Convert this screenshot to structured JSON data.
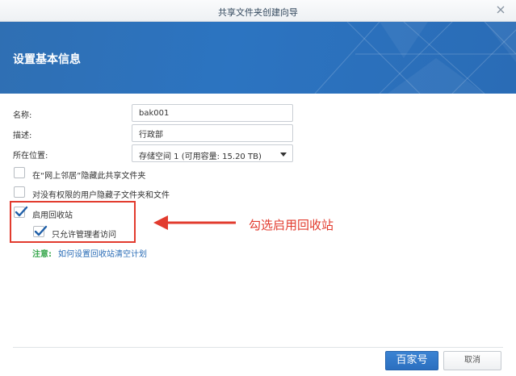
{
  "window": {
    "title": "共享文件夹创建向导"
  },
  "header": {
    "title": "设置基本信息"
  },
  "form": {
    "name_label": "名称:",
    "name_value": "bak001",
    "desc_label": "描述:",
    "desc_value": "行政部",
    "location_label": "所在位置:",
    "location_value": "存储空间 1 (可用容量: 15.20 TB)",
    "hide_network_label": "在“网上邻居”隐藏此共享文件夹",
    "hide_network_checked": false,
    "hide_subfolders_label": "对没有权限的用户隐藏子文件夹和文件",
    "hide_subfolders_checked": false,
    "enable_recycle_label": "启用回收站",
    "enable_recycle_checked": true,
    "admin_only_label": "只允许管理者访问",
    "admin_only_checked": true
  },
  "note": {
    "label": "注意:",
    "link_text": "如何设置回收站清空计划"
  },
  "annotation": {
    "text": "勾选启用回收站",
    "color": "#e23b2e"
  },
  "footer": {
    "next_label": "百家号",
    "cancel_label": "取消"
  },
  "colors": {
    "accent": "#2c74c1",
    "highlight": "#e23b2e",
    "note": "#3aa84f"
  }
}
